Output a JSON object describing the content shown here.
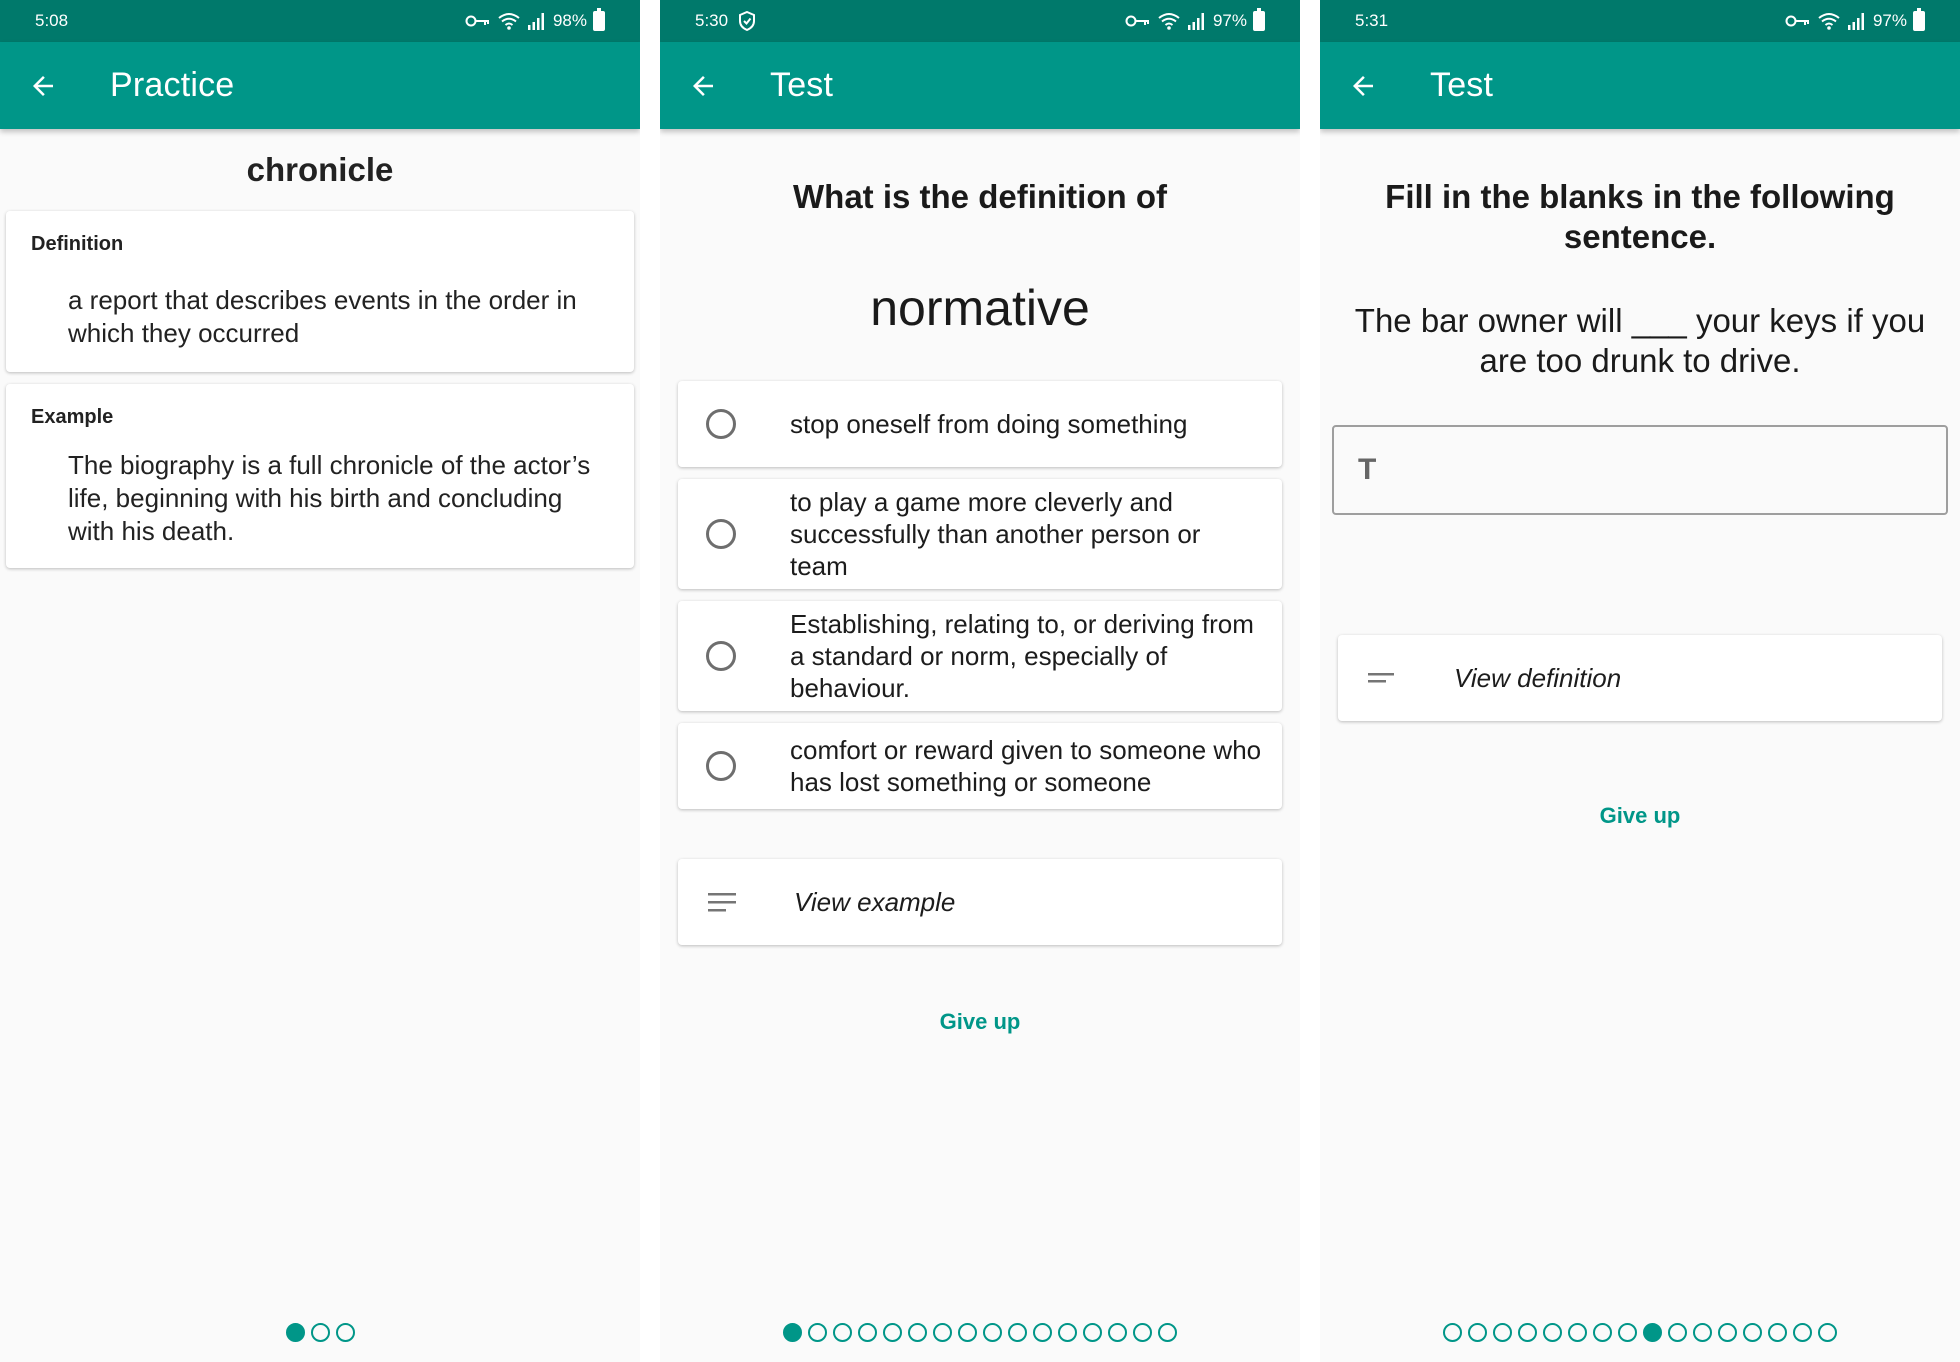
{
  "screens": [
    {
      "status": {
        "time": "5:08",
        "battery": "98%"
      },
      "appbar": {
        "title": "Practice"
      },
      "word": "chronicle",
      "definition": {
        "label": "Definition",
        "text": "a report that describes events in the order in which they occurred"
      },
      "example": {
        "label": "Example",
        "text": "The biography is a full chronicle of the actor’s life, beginning with his birth and concluding with his death."
      },
      "pager": {
        "total": 3,
        "active": 0
      }
    },
    {
      "status": {
        "time": "5:30",
        "battery": "97%"
      },
      "appbar": {
        "title": "Test"
      },
      "question": "What is the definition of",
      "term": "normative",
      "options": [
        "stop oneself from doing something",
        "to play a game more cleverly and successfully than another person or team",
        "Establishing, relating to, or deriving from a standard or norm, especially of behaviour.",
        "comfort or reward given to someone who has lost something or someone"
      ],
      "view_label": "View example",
      "give_up": "Give up",
      "pager": {
        "total": 16,
        "active": 0
      }
    },
    {
      "status": {
        "time": "5:31",
        "battery": "97%"
      },
      "appbar": {
        "title": "Test"
      },
      "question": "Fill in the blanks in the following sentence.",
      "sentence": "The bar owner will ___ your keys if you are too drunk to drive.",
      "input": {
        "placeholder": ""
      },
      "view_label": "View definition",
      "give_up": "Give up",
      "pager": {
        "total": 16,
        "active": 8
      }
    }
  ]
}
